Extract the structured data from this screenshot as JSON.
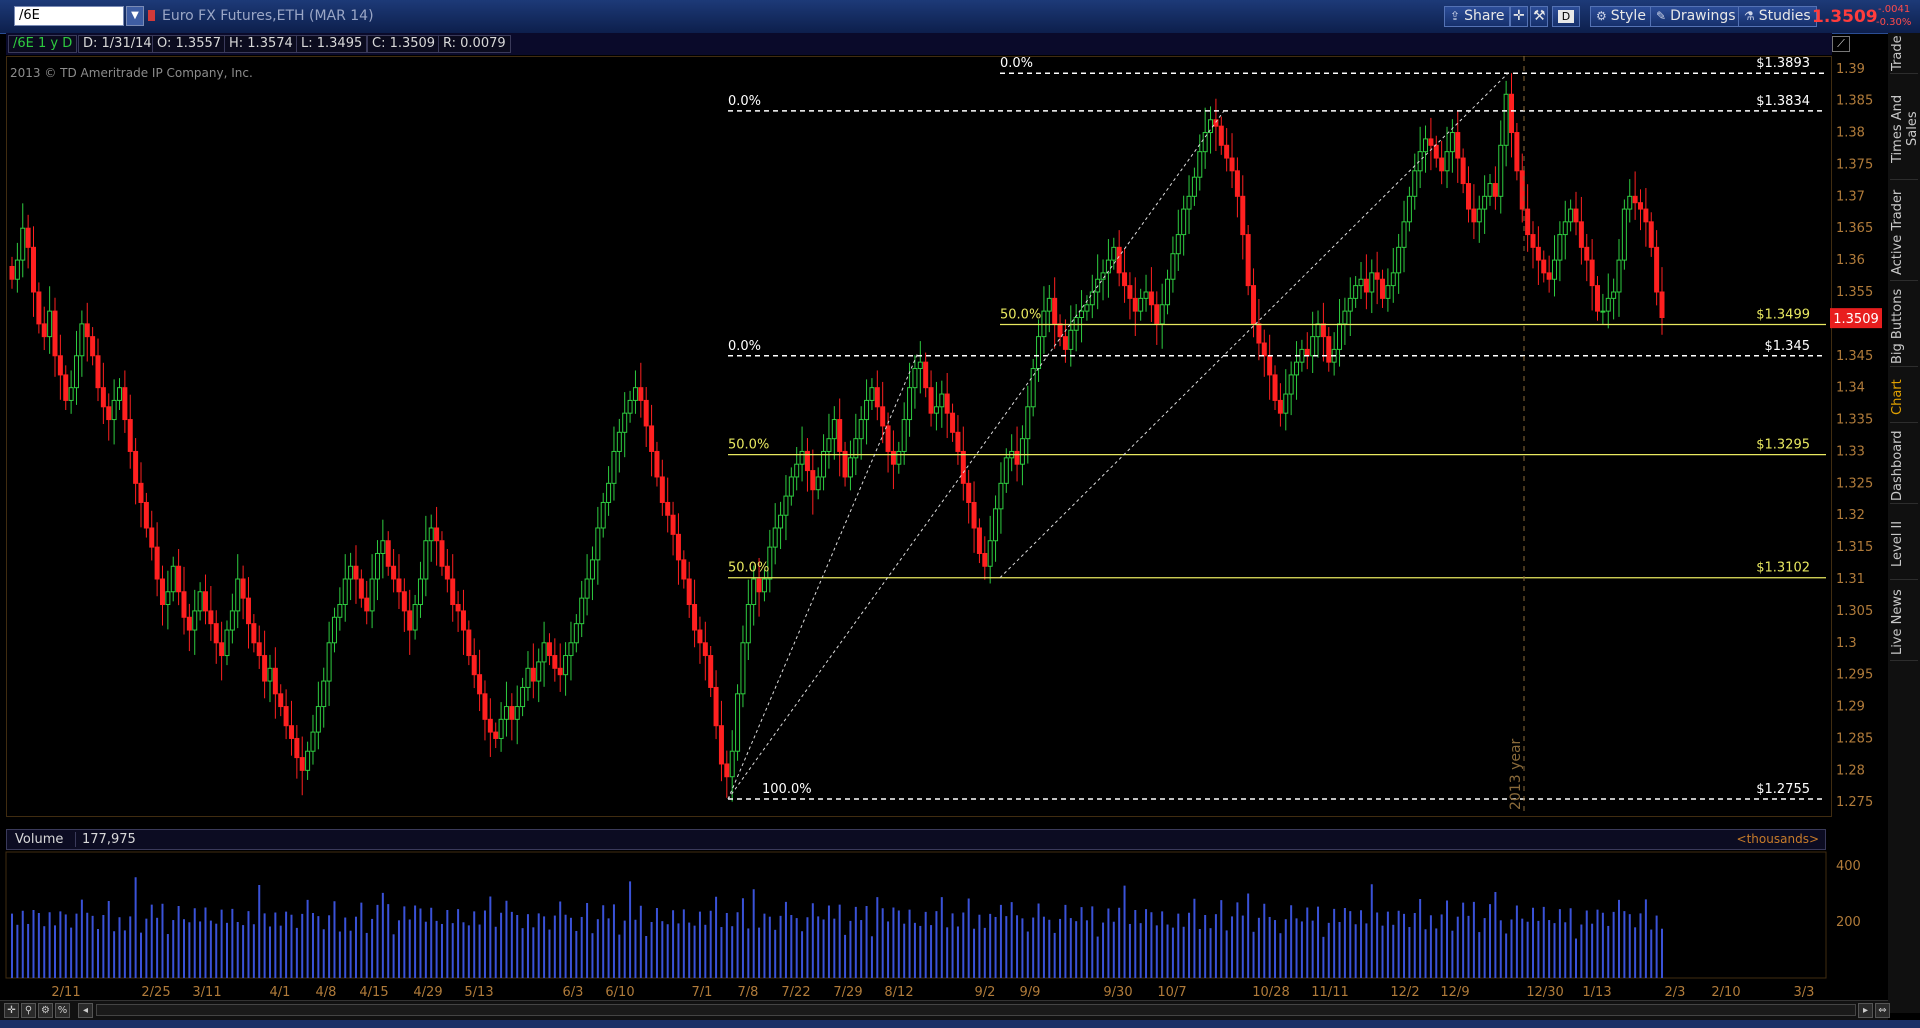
{
  "toolbar": {
    "symbol": "/6E",
    "instrument": "Euro FX Futures,ETH (MAR 14)",
    "share_label": "Share",
    "timeframe_label": "D",
    "style_label": "Style",
    "drawings_label": "Drawings",
    "studies_label": "Studies",
    "last_price": "1.3509",
    "net_change": "-.0041",
    "percent_change": "-0.30%"
  },
  "info": {
    "title": "/6E 1 y D",
    "date": "D: 1/31/14",
    "open": "O: 1.3557",
    "high": "H: 1.3574",
    "low": "L: 1.3495",
    "close": "C: 1.3509",
    "range": "R: 0.0079"
  },
  "copyright": "2013 © TD Ameritrade IP Company, Inc.",
  "volume": {
    "label": "Volume",
    "value": "177,975",
    "units": "<thousands>"
  },
  "side_tabs": [
    "Trade",
    "Times And Sales",
    "Active Trader",
    "Big Buttons",
    "Chart",
    "Dashboard",
    "Level II",
    "Live News"
  ],
  "chart_data": {
    "type": "candlestick",
    "symbol": "/6E",
    "period": "1 y D",
    "ylim": [
      1.273,
      1.392
    ],
    "y_ticks": [
      "1.39",
      "1.385",
      "1.38",
      "1.375",
      "1.37",
      "1.365",
      "1.36",
      "1.355",
      "1.35",
      "1.345",
      "1.34",
      "1.335",
      "1.33",
      "1.325",
      "1.32",
      "1.315",
      "1.31",
      "1.305",
      "1.3",
      "1.295",
      "1.29",
      "1.285",
      "1.28",
      "1.275"
    ],
    "x_ticks": [
      "2/11",
      "2/25",
      "3/11",
      "4/1",
      "4/8",
      "4/15",
      "4/29",
      "5/13",
      "6/3",
      "6/10",
      "7/1",
      "7/8",
      "7/22",
      "7/29",
      "8/12",
      "9/2",
      "9/9",
      "9/30",
      "10/7",
      "10/28",
      "11/11",
      "12/2",
      "12/9",
      "12/30",
      "1/13",
      "2/3",
      "2/10",
      "3/3"
    ],
    "year_marker": "2013 year",
    "fib_levels": [
      {
        "pct": "0.0%",
        "price": 1.3893,
        "label": "$1.3893"
      },
      {
        "pct": "0.0%",
        "price": 1.3834,
        "label": "$1.3834"
      },
      {
        "pct": "50.0%",
        "price": 1.3499,
        "label": "$1.3499"
      },
      {
        "pct": "0.0%",
        "price": 1.345,
        "label": "$1.345"
      },
      {
        "pct": "50.0%",
        "price": 1.3295,
        "label": "$1.3295"
      },
      {
        "pct": "50.0%",
        "price": 1.3102,
        "label": "$1.3102"
      },
      {
        "pct": "100.0%",
        "price": 1.2755,
        "label": "$1.2755"
      }
    ],
    "closes": [
      1.357,
      1.36,
      1.365,
      1.362,
      1.355,
      1.35,
      1.348,
      1.352,
      1.345,
      1.342,
      1.338,
      1.34,
      1.345,
      1.35,
      1.348,
      1.345,
      1.34,
      1.337,
      1.335,
      1.338,
      1.34,
      1.335,
      1.33,
      1.325,
      1.322,
      1.318,
      1.315,
      1.31,
      1.306,
      1.308,
      1.312,
      1.308,
      1.304,
      1.302,
      1.305,
      1.308,
      1.305,
      1.303,
      1.3,
      1.298,
      1.302,
      1.305,
      1.31,
      1.307,
      1.303,
      1.3,
      1.298,
      1.294,
      1.296,
      1.292,
      1.29,
      1.287,
      1.285,
      1.282,
      1.28,
      1.283,
      1.286,
      1.29,
      1.294,
      1.3,
      1.304,
      1.306,
      1.31,
      1.312,
      1.31,
      1.307,
      1.305,
      1.31,
      1.314,
      1.316,
      1.312,
      1.31,
      1.308,
      1.305,
      1.302,
      1.306,
      1.31,
      1.316,
      1.318,
      1.316,
      1.312,
      1.31,
      1.306,
      1.305,
      1.302,
      1.298,
      1.295,
      1.292,
      1.288,
      1.286,
      1.285,
      1.288,
      1.29,
      1.288,
      1.29,
      1.293,
      1.296,
      1.294,
      1.297,
      1.3,
      1.298,
      1.296,
      1.295,
      1.298,
      1.3,
      1.303,
      1.307,
      1.31,
      1.313,
      1.318,
      1.322,
      1.325,
      1.33,
      1.333,
      1.336,
      1.338,
      1.34,
      1.338,
      1.334,
      1.33,
      1.326,
      1.322,
      1.32,
      1.317,
      1.313,
      1.31,
      1.306,
      1.302,
      1.3,
      1.298,
      1.293,
      1.287,
      1.281,
      1.279,
      1.283,
      1.292,
      1.3,
      1.306,
      1.31,
      1.308,
      1.31,
      1.315,
      1.318,
      1.32,
      1.323,
      1.326,
      1.328,
      1.33,
      1.327,
      1.324,
      1.326,
      1.33,
      1.332,
      1.335,
      1.33,
      1.326,
      1.329,
      1.332,
      1.335,
      1.338,
      1.34,
      1.337,
      1.334,
      1.33,
      1.328,
      1.33,
      1.335,
      1.34,
      1.343,
      1.344,
      1.34,
      1.336,
      1.337,
      1.339,
      1.336,
      1.333,
      1.33,
      1.325,
      1.322,
      1.318,
      1.314,
      1.312,
      1.316,
      1.321,
      1.325,
      1.329,
      1.33,
      1.328,
      1.332,
      1.337,
      1.343,
      1.348,
      1.352,
      1.354,
      1.35,
      1.348,
      1.346,
      1.349,
      1.351,
      1.352,
      1.353,
      1.355,
      1.357,
      1.358,
      1.36,
      1.362,
      1.358,
      1.356,
      1.354,
      1.352,
      1.354,
      1.355,
      1.353,
      1.35,
      1.353,
      1.357,
      1.361,
      1.364,
      1.368,
      1.37,
      1.373,
      1.377,
      1.38,
      1.382,
      1.381,
      1.378,
      1.376,
      1.374,
      1.37,
      1.364,
      1.356,
      1.35,
      1.347,
      1.345,
      1.342,
      1.338,
      1.336,
      1.339,
      1.342,
      1.344,
      1.346,
      1.345,
      1.348,
      1.35,
      1.348,
      1.344,
      1.346,
      1.35,
      1.352,
      1.354,
      1.356,
      1.357,
      1.355,
      1.358,
      1.357,
      1.354,
      1.356,
      1.358,
      1.362,
      1.366,
      1.37,
      1.374,
      1.377,
      1.379,
      1.378,
      1.376,
      1.374,
      1.377,
      1.38,
      1.376,
      1.372,
      1.368,
      1.366,
      1.368,
      1.37,
      1.372,
      1.37,
      1.378,
      1.386,
      1.38,
      1.374,
      1.368,
      1.364,
      1.362,
      1.36,
      1.358,
      1.357,
      1.36,
      1.364,
      1.366,
      1.368,
      1.366,
      1.362,
      1.36,
      1.356,
      1.352,
      1.352,
      1.354,
      1.355,
      1.36,
      1.368,
      1.37,
      1.369,
      1.368,
      1.366,
      1.362,
      1.355,
      1.351
    ]
  }
}
